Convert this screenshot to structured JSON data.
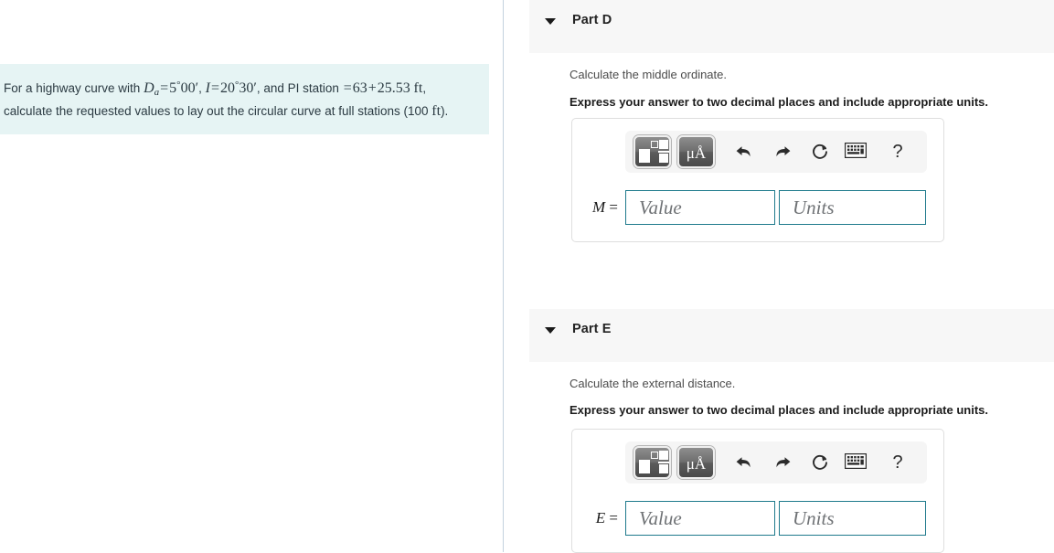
{
  "problem": {
    "intro": "For a highway curve with",
    "symbol_d": "D",
    "symbol_d_sub": "a",
    "eq1": "=",
    "val_d": "5",
    "deg1": "°",
    "min_d": "00′",
    "comma1": ",",
    "symbol_i": "I",
    "eq2": "=",
    "val_i": "20",
    "deg2": "°",
    "min_i": "30′",
    "mid": ", and PI station",
    "eq3": "=",
    "sta1": "63",
    "plus": "+",
    "sta2": "25.53",
    "unit_ft": "ft",
    "tail": ", calculate the requested values to lay out the circular curve at full stations (100",
    "unit_ft2": "ft",
    "tail_end": ")."
  },
  "parts": [
    {
      "title": "Part D",
      "prompt": "Calculate the middle ordinate.",
      "instruction": "Express your answer to two decimal places and include appropriate units.",
      "variable": "M",
      "equals": "=",
      "value_placeholder": "Value",
      "units_placeholder": "Units",
      "value_current": "",
      "units_current": "",
      "toolbar": {
        "template_button": "math-template",
        "units_button": "μÅ",
        "undo": "undo",
        "redo": "redo",
        "reset": "reset",
        "keyboard": "keyboard",
        "help": "?"
      }
    },
    {
      "title": "Part E",
      "prompt": "Calculate the external distance.",
      "instruction": "Express your answer to two decimal places and include appropriate units.",
      "variable": "E",
      "equals": "=",
      "value_placeholder": "Value",
      "units_placeholder": "Units",
      "value_current": "",
      "units_current": "",
      "toolbar": {
        "template_button": "math-template",
        "units_button": "μÅ",
        "undo": "undo",
        "redo": "redo",
        "reset": "reset",
        "keyboard": "keyboard",
        "help": "?"
      }
    }
  ],
  "colors": {
    "problem_background": "#e6f4f4",
    "header_background": "#f7f7f7",
    "input_border": "#1f7a8c",
    "divider": "#c3d2de",
    "toolbar_background": "#f5f5f5"
  }
}
